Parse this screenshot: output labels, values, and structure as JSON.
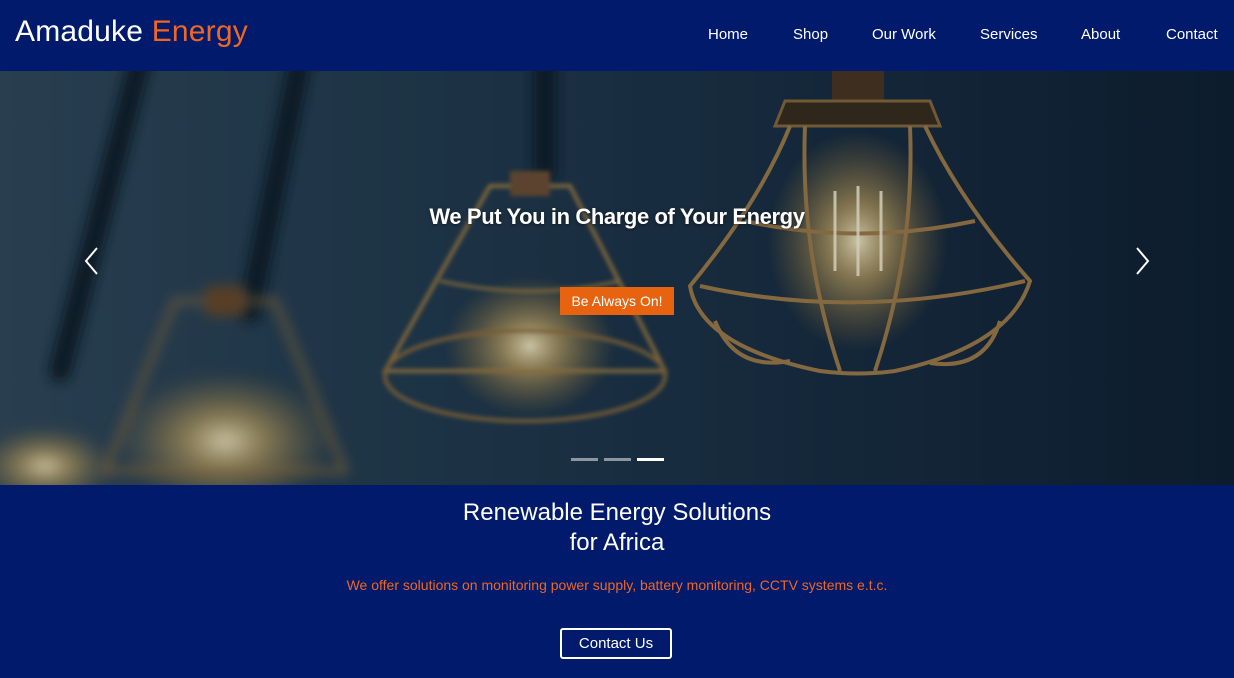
{
  "brand": {
    "name_primary": "Amaduke",
    "name_accent": "Energy"
  },
  "nav": {
    "items": [
      {
        "label": "Home"
      },
      {
        "label": "Shop"
      },
      {
        "label": "Our Work"
      },
      {
        "label": "Services"
      },
      {
        "label": "About"
      },
      {
        "label": "Contact"
      }
    ]
  },
  "hero": {
    "title": "We Put You in Charge of Your Energy",
    "cta_label": "Be Always On!",
    "prev_icon": "chevron-left-icon",
    "next_icon": "chevron-right-icon",
    "slide_count": 3,
    "active_slide": 3
  },
  "section": {
    "headline_line1": "Renewable Energy Solutions",
    "headline_line2": "for Africa",
    "subtext": "We offer solutions on monitoring power supply, battery monitoring, CCTV systems e.t.c.",
    "contact_label": "Contact Us"
  },
  "colors": {
    "background": "#011a6b",
    "accent": "#ee6723",
    "cta": "#e8630f",
    "text": "#ffffff"
  }
}
